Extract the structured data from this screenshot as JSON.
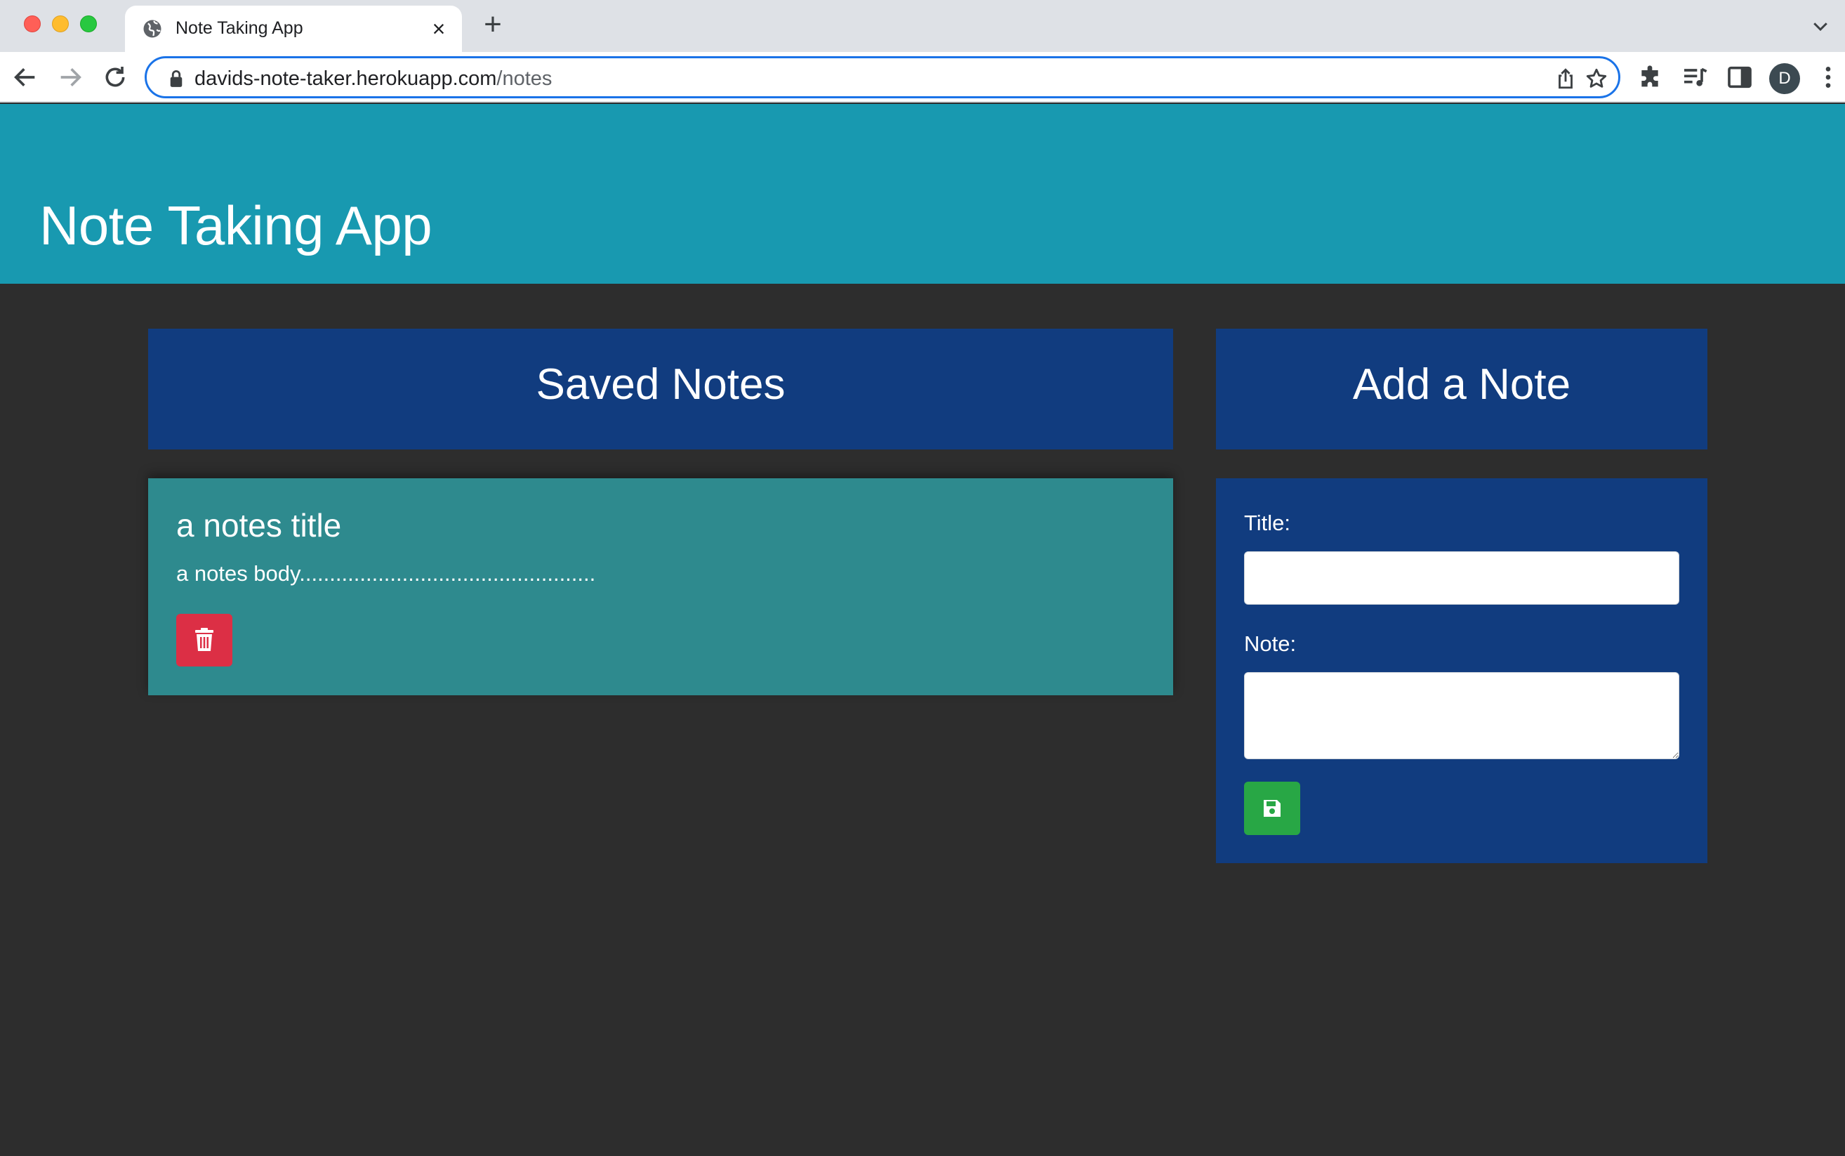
{
  "browser": {
    "tab_title": "Note Taking App",
    "tab_close_icon": "close-icon",
    "new_tab_label": "+",
    "url_host": "davids-note-taker.herokuapp.com",
    "url_path": "/notes",
    "profile_initial": "D",
    "omnibox_focus_color": "#1a73e8"
  },
  "header": {
    "title": "Note Taking App",
    "background": "#1899b0"
  },
  "saved_notes": {
    "heading": "Saved Notes",
    "notes": [
      {
        "title": "a notes title",
        "body": "a notes body.................................................",
        "delete_icon": "trash-icon"
      }
    ]
  },
  "add_note": {
    "heading": "Add a Note",
    "title_label": "Title:",
    "title_value": "",
    "note_label": "Note:",
    "note_value": "",
    "save_icon": "floppy-disk-icon"
  },
  "colors": {
    "panel": "#113c7f",
    "note_card": "#2e8a8e",
    "delete": "#dc2f45",
    "save": "#28a745",
    "page_background": "#2d2d2d"
  }
}
